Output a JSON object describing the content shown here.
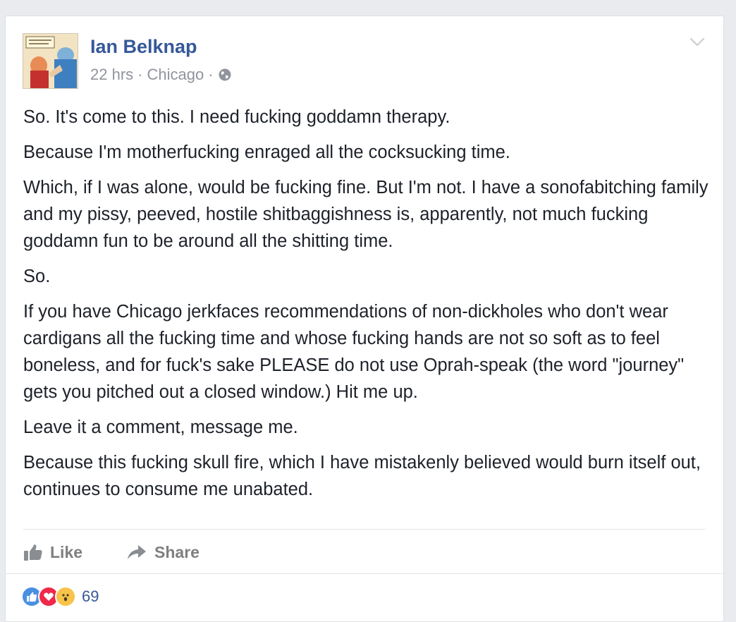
{
  "post": {
    "author": "Ian Belknap",
    "time": "22 hrs",
    "location": "Chicago",
    "separator": "·",
    "paragraphs": [
      "So. It's come to this. I need fucking goddamn therapy.",
      "Because I'm motherfucking enraged all the cocksucking time.",
      "Which, if I was alone, would be fucking fine. But I'm not. I have a sonofabitching family and my pissy, peeved, hostile shitbaggishness is, apparently, not much fucking goddamn fun to be around all the shitting time.",
      "So.",
      "If you have Chicago jerkfaces recommendations of non-dickholes who don't wear cardigans all the fucking time and whose fucking hands are not so soft as to feel boneless, and for fuck's sake PLEASE do not use Oprah-speak (the word \"journey\" gets you pitched out a closed window.) Hit me up.",
      "Leave it a comment, message me.",
      "Because this fucking skull fire, which I have mistakenly believed would burn itself out, continues to consume me unabated."
    ]
  },
  "actions": {
    "like_label": "Like",
    "share_label": "Share"
  },
  "reactions": {
    "types": [
      "like",
      "love",
      "wow"
    ],
    "count": "69"
  },
  "colors": {
    "author_link": "#365899",
    "meta_text": "#90949c",
    "body_text": "#1d2129",
    "like_blue": "#4a90e2",
    "love_red": "#f0284a",
    "wow_yellow": "#f7c34b"
  },
  "icons": {
    "privacy": "globe-icon",
    "menu": "chevron-down-icon",
    "like": "thumbs-up-icon",
    "share": "share-arrow-icon"
  }
}
